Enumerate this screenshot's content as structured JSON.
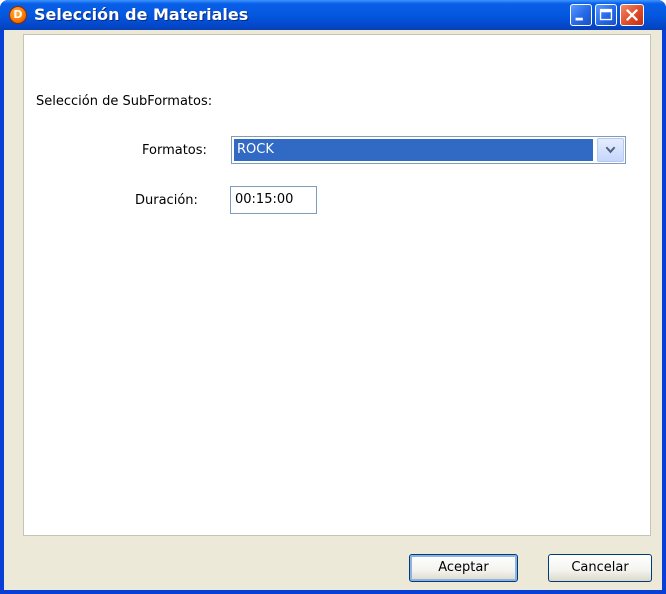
{
  "window": {
    "title": "Selección de Materiales",
    "app_icon_letter": "D",
    "controls": [
      "minimize-icon",
      "maximize-icon",
      "close-icon"
    ]
  },
  "form": {
    "section_label": "Selección de SubFormatos:",
    "formatos_label": "Formatos:",
    "formatos_value": "ROCK",
    "duracion_label": "Duración:",
    "duracion_value": "00:15:00"
  },
  "buttons": {
    "aceptar": "Aceptar",
    "cancelar": "Cancelar"
  },
  "colors": {
    "titlebar": "#0458e0",
    "selection": "#316ac5",
    "dialog_bg": "#ece9d8"
  }
}
